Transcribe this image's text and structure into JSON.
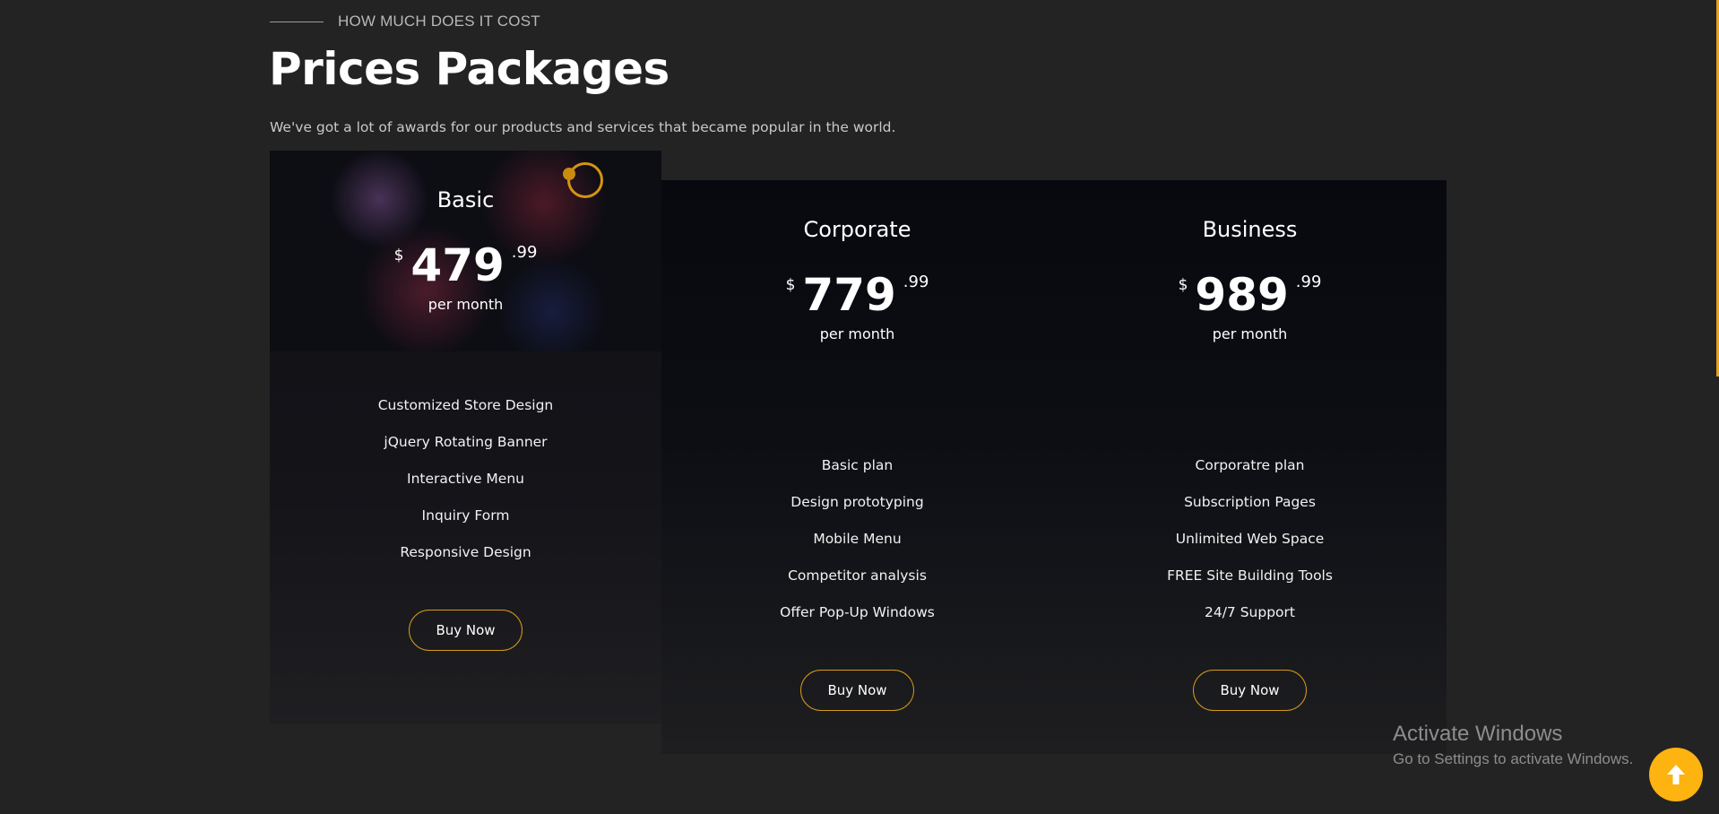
{
  "section": {
    "eyebrow": "HOW MUCH DOES IT COST",
    "title": "Prices Packages",
    "subtitle": "We've got a lot of awards for our products and services that became popular in the world."
  },
  "plans": [
    {
      "name": "Basic",
      "currency": "$",
      "amount": "479",
      "cents": ".99",
      "period": "per month",
      "features": [
        "Customized Store Design",
        "jQuery Rotating Banner",
        "Interactive Menu",
        "Inquiry Form",
        "Responsive Design"
      ],
      "button": "Buy Now"
    },
    {
      "name": "Corporate",
      "currency": "$",
      "amount": "779",
      "cents": ".99",
      "period": "per month",
      "features": [
        "Basic plan",
        "Design prototyping",
        "Mobile Menu",
        "Competitor analysis",
        "Offer Pop-Up Windows"
      ],
      "button": "Buy Now"
    },
    {
      "name": "Business",
      "currency": "$",
      "amount": "989",
      "cents": ".99",
      "period": "per month",
      "features": [
        "Corporatre plan",
        "Subscription Pages",
        "Unlimited Web Space",
        "FREE Site Building Tools",
        "24/7 Support"
      ],
      "button": "Buy Now"
    }
  ],
  "watermark": {
    "title": "Activate Windows",
    "subtitle": "Go to Settings to activate Windows."
  },
  "scroll_top": {
    "icon": "arrow-up-icon"
  },
  "colors": {
    "accent": "#fdb310",
    "background": "#232323",
    "card": "#0a0c12"
  }
}
